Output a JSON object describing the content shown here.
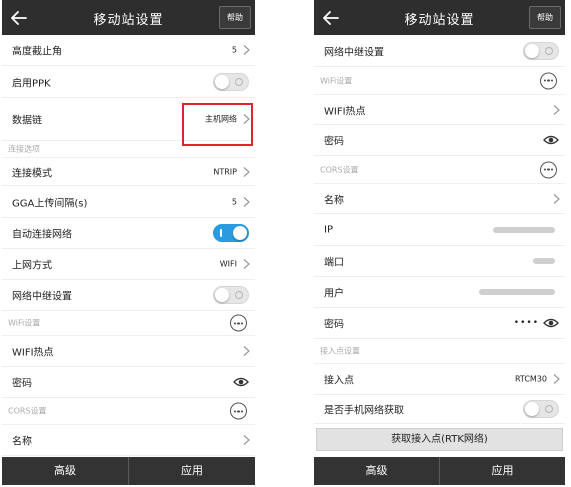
{
  "left": {
    "appbar": {
      "title": "移动站设置",
      "help_label": "帮助"
    },
    "rows": {
      "elevation_mask": {
        "label": "高度截止角",
        "value": "5"
      },
      "enable_ppk": {
        "label": "启用PPK"
      },
      "datalink": {
        "label": "数据链",
        "value": "主机网络"
      },
      "connection_section": {
        "label": "连接选项"
      },
      "connect_mode": {
        "label": "连接模式",
        "value": "NTRIP"
      },
      "gga_interval": {
        "label": "GGA上传间隔(s)",
        "value": "5"
      },
      "auto_connect": {
        "label": "自动连接网络"
      },
      "internet_method": {
        "label": "上网方式",
        "value": "WIFI"
      },
      "network_relay": {
        "label": "网络中继设置"
      },
      "wifi_section": {
        "label": "WiFi设置"
      },
      "wifi_hotspot": {
        "label": "WIFI热点"
      },
      "password": {
        "label": "密码"
      },
      "cors_section": {
        "label": "CORS设置"
      },
      "name": {
        "label": "名称"
      }
    },
    "toggles": {
      "enable_ppk": false,
      "auto_connect": true,
      "network_relay": false
    },
    "bottom": {
      "advanced_label": "高级",
      "apply_label": "应用"
    }
  },
  "right": {
    "appbar": {
      "title": "移动站设置",
      "help_label": "帮助"
    },
    "rows": {
      "network_relay": {
        "label": "网络中继设置"
      },
      "wifi_section": {
        "label": "WiFi设置"
      },
      "wifi_hotspot": {
        "label": "WIFI热点"
      },
      "wifi_password": {
        "label": "密码"
      },
      "cors_section": {
        "label": "CORS设置"
      },
      "name": {
        "label": "名称"
      },
      "ip": {
        "label": "IP"
      },
      "port": {
        "label": "端口"
      },
      "user": {
        "label": "用户"
      },
      "cors_password": {
        "label": "密码",
        "masked_value": "••••"
      },
      "mountpoint_section": {
        "label": "接入点设置"
      },
      "mountpoint": {
        "label": "接入点",
        "value": "RTCM30"
      },
      "get_from_phone": {
        "label": "是否手机网络获取"
      }
    },
    "toggles": {
      "network_relay": false,
      "get_from_phone": false
    },
    "get_mountpoint_button": "获取接入点(RTK网络)",
    "bottom": {
      "advanced_label": "高级",
      "apply_label": "应用"
    }
  },
  "colors": {
    "appbar": "#2e2e2e",
    "bottombar": "#333333",
    "toggle_on": "#2a9be0",
    "highlight": "#e0242b"
  }
}
